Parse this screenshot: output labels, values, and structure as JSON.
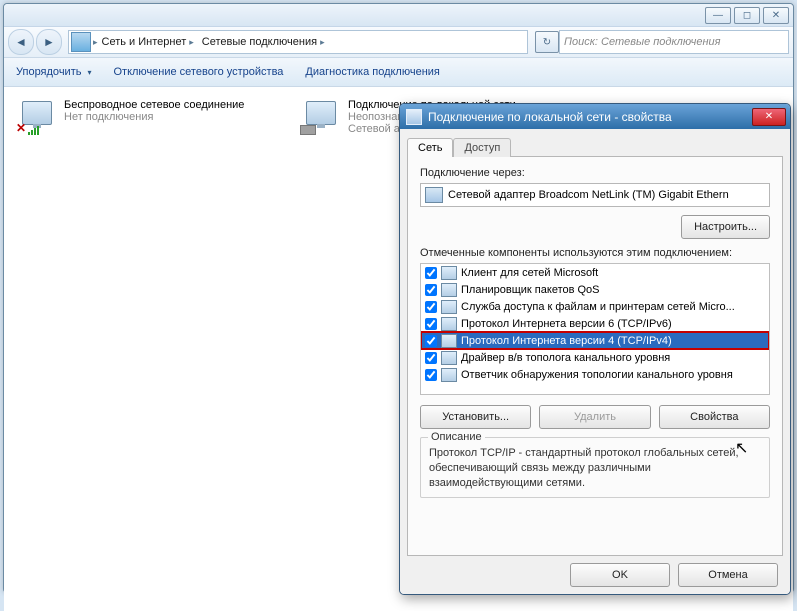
{
  "explorer": {
    "breadcrumbs": [
      "Сеть и Интернет",
      "Сетевые подключения"
    ],
    "search_placeholder": "Поиск: Сетевые подключения",
    "toolbar": {
      "organize": "Упорядочить",
      "disable": "Отключение сетевого устройства",
      "diagnose": "Диагностика подключения"
    },
    "connections": [
      {
        "title": "Беспроводное сетевое соединение",
        "status": "",
        "sub": "Нет подключения"
      },
      {
        "title": "Подключение по локальной сети",
        "status": "Неопознанная",
        "sub": "Сетевой адаптер"
      }
    ]
  },
  "dialog": {
    "title": "Подключение по локальной сети - свойства",
    "tabs": {
      "network": "Сеть",
      "access": "Доступ"
    },
    "connect_via_label": "Подключение через:",
    "adapter": "Сетевой адаптер Broadcom NetLink (TM) Gigabit Ethern",
    "configure": "Настроить...",
    "components_label": "Отмеченные компоненты используются этим подключением:",
    "items": [
      "Клиент для сетей Microsoft",
      "Планировщик пакетов QoS",
      "Служба доступа к файлам и принтерам сетей Micro...",
      "Протокол Интернета версии 6 (TCP/IPv6)",
      "Протокол Интернета версии 4 (TCP/IPv4)",
      "Драйвер в/в тополога канального уровня",
      "Ответчик обнаружения топологии канального уровня"
    ],
    "buttons": {
      "install": "Установить...",
      "remove": "Удалить",
      "properties": "Свойства"
    },
    "group_title": "Описание",
    "description": "Протокол TCP/IP - стандартный протокол глобальных сетей, обеспечивающий связь между различными взаимодействующими сетями.",
    "footer": {
      "ok": "OK",
      "cancel": "Отмена"
    }
  }
}
